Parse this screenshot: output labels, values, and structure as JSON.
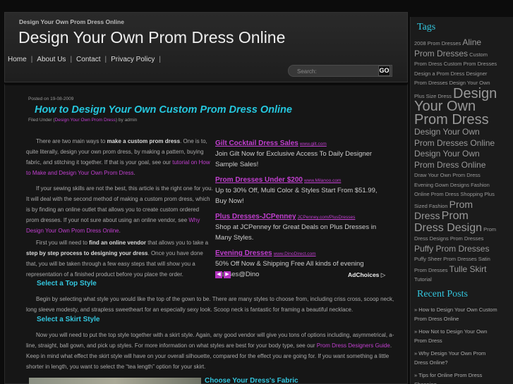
{
  "site": {
    "tagline": "Design Your Own Prom Dress Online",
    "title": "Design Your Own Prom Dress Online"
  },
  "nav": {
    "items": [
      "Home",
      "About Us",
      "Contact",
      "Privacy Policy"
    ],
    "separator": "|"
  },
  "search": {
    "placeholder": "Search:",
    "button_label": "GO"
  },
  "post": {
    "date": "Posted on 19-08-2009",
    "title": "How to Design Your Own Custom Prom Dress Online",
    "filed_prefix": "Filed Under (",
    "category": "Design Your Own Prom Dress",
    "filed_suffix": ") by admin",
    "p1_text": "There are two main ways to ",
    "p1_bold": "make a custom prom dress",
    "p1_rest": ". One is to, quite literally, design your own prom dress, by making a pattern, buying fabric, and stitching it together. If that is your goal, see our ",
    "p1_link": "tutorial on How to Make and Design Your Own Prom Dress",
    "p1_end": ".",
    "p2_text": "If your sewing skills are not the best, this article is the right one for you. It will deal with the second method of making a custom prom dress, which is by finding an online outlet that allows you to create custom ordered prom dresses. If your not sure about using an online vendor, see ",
    "p2_link": "Why Design Your Own Prom Dress Online",
    "p2_end": ".",
    "p3_text": "First you will need to ",
    "p3_bold1": "find an online vendor",
    "p3_mid": " that allows you to take a ",
    "p3_bold2": "step by step process to designing your dress",
    "p3_rest": ". Once you have done that, you will be taken through a few easy steps that will show you a representation of a finished product before you place the order.",
    "h1": "Select a Top Style",
    "p4_text": "Begin by selecting what style you would like the top of the gown to be. There are many styles to choose from, including criss cross, scoop neck, long sleeve modesty, and strapless sweetheart for an especially sexy look. Scoop neck is fantastic for framing a beautiful necklace.",
    "h2": "Select a Skirt Style",
    "p5_text": "Now you will need to put the top style together with a skirt style. Again, any good vendor will give you tons of options including, asymmetrical, a-line, straight, ball gown, and pick up styles. For more information on what styles are best for your body type, see our ",
    "p5_link": "Prom Dress Designers Guide",
    "p5_rest": ". Keep in mind what effect the skirt style will have on your overall silhouette, compared for the effect you are going for. If you want something a little shorter in length, you want to select the “tea length” option for your skirt.",
    "h3": "Choose Your Dress's Fabric"
  },
  "ads": [
    {
      "title": "Gilt Cocktail Dress Sales",
      "url": "www.gilt.com",
      "desc": "Join Gilt Now for Exclusive Access To Daily Designer Sample Sales!"
    },
    {
      "title": "Prom Dresses Under $200",
      "url": "www.Milanoo.com",
      "desc": "Up to 30% Off, Multi Color & Styles Start From $51.99, Buy Now!"
    },
    {
      "title": "Plus Dresses-JCPenney",
      "url": "JCPenney.com/PlusDresses",
      "desc": "Shop at JCPenney for Great Deals on Plus Dresses in Many Styles."
    },
    {
      "title": "Evening Dresses",
      "url": "www.DinoDirect.com",
      "desc": "50% Off Now & Shipping Free All kinds of evening dresses@Dino"
    }
  ],
  "ad_nav": {
    "prev": "◀",
    "next": "▶"
  },
  "adchoices": "AdChoices ▷",
  "sidebar": {
    "tags_heading": "Tags",
    "tags": [
      {
        "text": "2008 Prom Dresses",
        "size": 1
      },
      {
        "text": "Aline Prom Dresses",
        "size": 2
      },
      {
        "text": "Custom Prom Dress",
        "size": 1
      },
      {
        "text": "Custom Prom Dresses",
        "size": 1
      },
      {
        "text": "Design a Prom Dress",
        "size": 1
      },
      {
        "text": "Designer Prom Dresses",
        "size": 1
      },
      {
        "text": "Design Your Own Plus Size Dress",
        "size": 1
      },
      {
        "text": "Design Your Own Prom Dress",
        "size": 4
      },
      {
        "text": "Design Your Own Prom Dresses Online",
        "size": 2
      },
      {
        "text": "Design Your Own Prom Dress Online",
        "size": 2
      },
      {
        "text": "Draw Your Own Prom Dress",
        "size": 1
      },
      {
        "text": "Evening Gown Designs",
        "size": 1
      },
      {
        "text": "Fashion Online Prom Dress Shopping",
        "size": 1
      },
      {
        "text": "Plus Sized Fashion",
        "size": 1
      },
      {
        "text": "Prom Dress",
        "size": 5
      },
      {
        "text": "Prom Dress Design",
        "size": 3
      },
      {
        "text": "Prom Dress Designs",
        "size": 1
      },
      {
        "text": "Prom Dresses",
        "size": 1
      },
      {
        "text": "Puffy Prom Dresses",
        "size": 2
      },
      {
        "text": "Puffy Sheer Prom Dresses",
        "size": 1
      },
      {
        "text": "Satin Prom Dresses",
        "size": 1
      },
      {
        "text": "Tulle Skirt",
        "size": 2
      },
      {
        "text": "Tutorial",
        "size": 1
      }
    ],
    "recent_heading": "Recent Posts",
    "recent": [
      "How to Design Your Own Custom Prom Dress Online",
      "How Not to Design Your Own Prom Dress",
      "Why Design Your Own Prom Dress Online?",
      "Tips for Online Prom Dress Shopping"
    ]
  }
}
